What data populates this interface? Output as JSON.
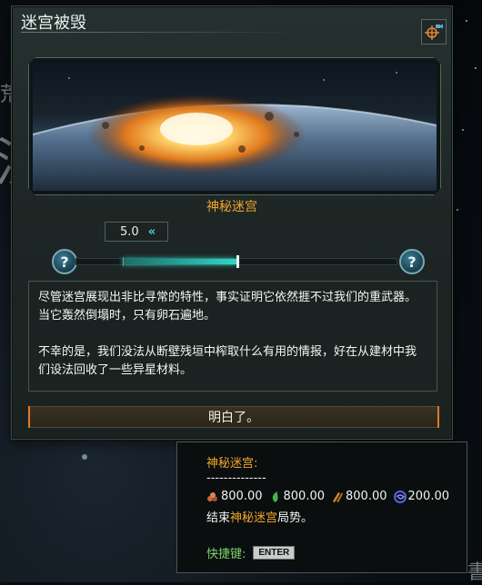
{
  "dialog": {
    "title": "迷宫被毁",
    "camera_icon": "camera-locate-icon",
    "image_alt": "planet-explosion-image",
    "caption": "神秘迷宫",
    "slider": {
      "value_text": "5.0",
      "fast_forward_icon": "«",
      "fill_fraction": 0.5,
      "help_label": "?"
    },
    "text": {
      "paragraph1": "尽管迷宫展现出非比寻常的特性，事实证明它依然捱不过我们的重武器。当它轰然倒塌时，只有卵石遍地。",
      "paragraph2": "不幸的是，我们没法从断壁残垣中榨取什么有用的情报，好在从建材中我们设法回收了一些异星材料。"
    },
    "ok_button": "明白了。"
  },
  "tooltip": {
    "title": "神秘迷宫:",
    "separator": "--------------",
    "resources": [
      {
        "icon": "minerals-icon",
        "value": "800.00",
        "color": "#c46a3a"
      },
      {
        "icon": "food-icon",
        "value": "800.00",
        "color": "#48b54a"
      },
      {
        "icon": "alloys-icon",
        "value": "800.00",
        "color": "#e08a2c"
      },
      {
        "icon": "exotic-gas-icon",
        "value": "200.00",
        "color": "#5a5fe0"
      }
    ],
    "desc_prefix": "结束",
    "desc_highlight": "神秘迷宫",
    "desc_suffix": "局势。",
    "hotkey_label": "快捷键:",
    "hotkey_key": "ENTER"
  },
  "background": {
    "glyphs": [
      "荒",
      "汉",
      "書"
    ]
  }
}
